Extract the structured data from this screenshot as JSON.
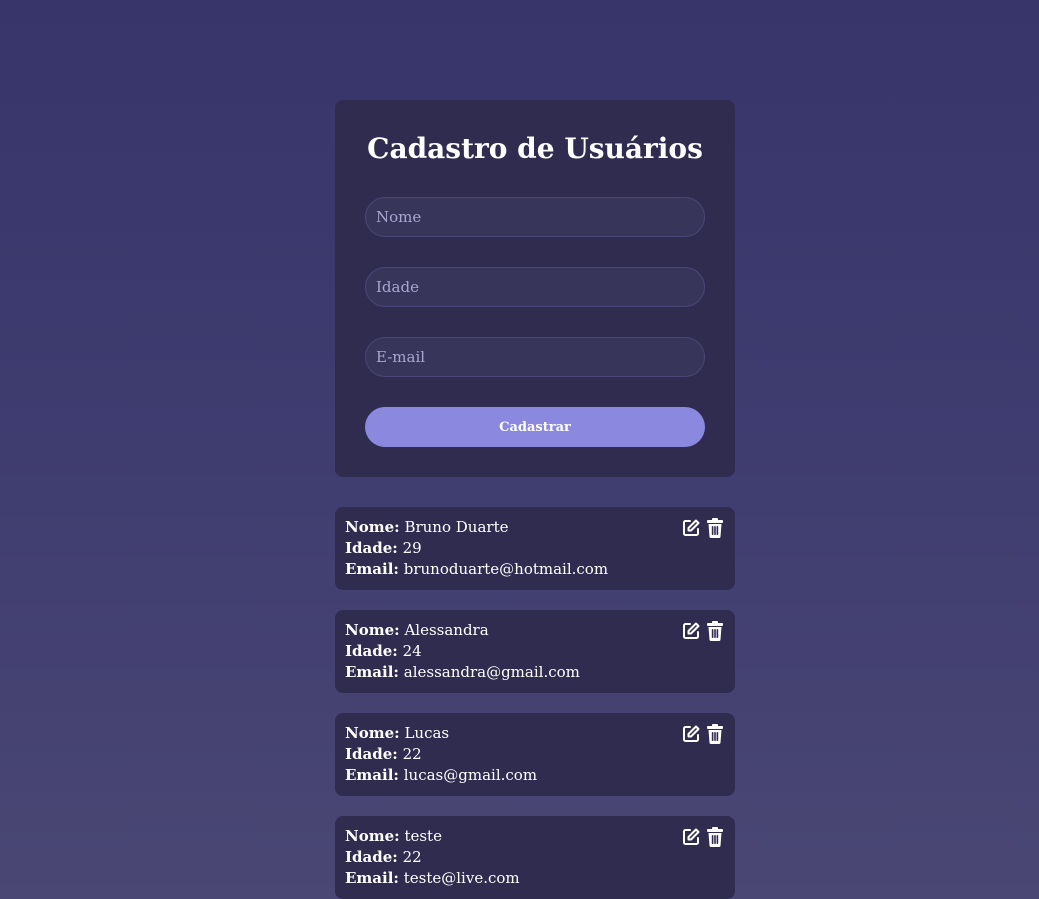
{
  "form": {
    "title": "Cadastro de Usuários",
    "fields": {
      "nome_placeholder": "Nome",
      "idade_placeholder": "Idade",
      "email_placeholder": "E-mail"
    },
    "submit_label": "Cadastrar"
  },
  "labels": {
    "nome": "Nome:",
    "idade": "Idade:",
    "email": "Email:"
  },
  "icons": {
    "edit": "edit-icon",
    "delete": "trash-icon"
  },
  "colors": {
    "card_bg": "#2f2c4f",
    "button_bg": "#8b88e0",
    "page_bg_top": "#37356a",
    "page_bg_bottom": "#4a4774"
  },
  "users": [
    {
      "nome": "Bruno Duarte",
      "idade": "29",
      "email": "brunoduarte@hotmail.com"
    },
    {
      "nome": "Alessandra",
      "idade": "24",
      "email": "alessandra@gmail.com"
    },
    {
      "nome": "Lucas",
      "idade": "22",
      "email": "lucas@gmail.com"
    },
    {
      "nome": "teste",
      "idade": "22",
      "email": "teste@live.com"
    }
  ]
}
